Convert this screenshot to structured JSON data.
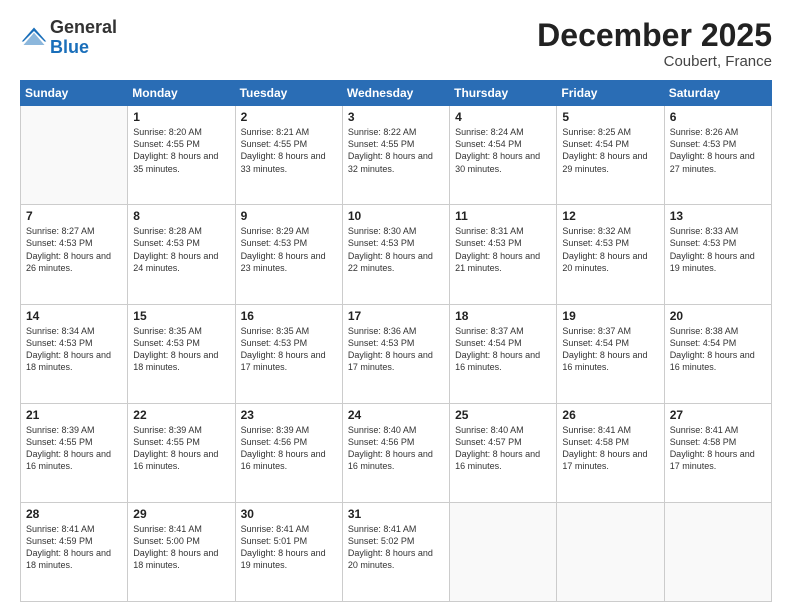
{
  "logo": {
    "general": "General",
    "blue": "Blue"
  },
  "header": {
    "month": "December 2025",
    "location": "Coubert, France"
  },
  "days_of_week": [
    "Sunday",
    "Monday",
    "Tuesday",
    "Wednesday",
    "Thursday",
    "Friday",
    "Saturday"
  ],
  "weeks": [
    [
      {
        "day": "",
        "sunrise": "",
        "sunset": "",
        "daylight": ""
      },
      {
        "day": "1",
        "sunrise": "Sunrise: 8:20 AM",
        "sunset": "Sunset: 4:55 PM",
        "daylight": "Daylight: 8 hours and 35 minutes."
      },
      {
        "day": "2",
        "sunrise": "Sunrise: 8:21 AM",
        "sunset": "Sunset: 4:55 PM",
        "daylight": "Daylight: 8 hours and 33 minutes."
      },
      {
        "day": "3",
        "sunrise": "Sunrise: 8:22 AM",
        "sunset": "Sunset: 4:55 PM",
        "daylight": "Daylight: 8 hours and 32 minutes."
      },
      {
        "day": "4",
        "sunrise": "Sunrise: 8:24 AM",
        "sunset": "Sunset: 4:54 PM",
        "daylight": "Daylight: 8 hours and 30 minutes."
      },
      {
        "day": "5",
        "sunrise": "Sunrise: 8:25 AM",
        "sunset": "Sunset: 4:54 PM",
        "daylight": "Daylight: 8 hours and 29 minutes."
      },
      {
        "day": "6",
        "sunrise": "Sunrise: 8:26 AM",
        "sunset": "Sunset: 4:53 PM",
        "daylight": "Daylight: 8 hours and 27 minutes."
      }
    ],
    [
      {
        "day": "7",
        "sunrise": "Sunrise: 8:27 AM",
        "sunset": "Sunset: 4:53 PM",
        "daylight": "Daylight: 8 hours and 26 minutes."
      },
      {
        "day": "8",
        "sunrise": "Sunrise: 8:28 AM",
        "sunset": "Sunset: 4:53 PM",
        "daylight": "Daylight: 8 hours and 24 minutes."
      },
      {
        "day": "9",
        "sunrise": "Sunrise: 8:29 AM",
        "sunset": "Sunset: 4:53 PM",
        "daylight": "Daylight: 8 hours and 23 minutes."
      },
      {
        "day": "10",
        "sunrise": "Sunrise: 8:30 AM",
        "sunset": "Sunset: 4:53 PM",
        "daylight": "Daylight: 8 hours and 22 minutes."
      },
      {
        "day": "11",
        "sunrise": "Sunrise: 8:31 AM",
        "sunset": "Sunset: 4:53 PM",
        "daylight": "Daylight: 8 hours and 21 minutes."
      },
      {
        "day": "12",
        "sunrise": "Sunrise: 8:32 AM",
        "sunset": "Sunset: 4:53 PM",
        "daylight": "Daylight: 8 hours and 20 minutes."
      },
      {
        "day": "13",
        "sunrise": "Sunrise: 8:33 AM",
        "sunset": "Sunset: 4:53 PM",
        "daylight": "Daylight: 8 hours and 19 minutes."
      }
    ],
    [
      {
        "day": "14",
        "sunrise": "Sunrise: 8:34 AM",
        "sunset": "Sunset: 4:53 PM",
        "daylight": "Daylight: 8 hours and 18 minutes."
      },
      {
        "day": "15",
        "sunrise": "Sunrise: 8:35 AM",
        "sunset": "Sunset: 4:53 PM",
        "daylight": "Daylight: 8 hours and 18 minutes."
      },
      {
        "day": "16",
        "sunrise": "Sunrise: 8:35 AM",
        "sunset": "Sunset: 4:53 PM",
        "daylight": "Daylight: 8 hours and 17 minutes."
      },
      {
        "day": "17",
        "sunrise": "Sunrise: 8:36 AM",
        "sunset": "Sunset: 4:53 PM",
        "daylight": "Daylight: 8 hours and 17 minutes."
      },
      {
        "day": "18",
        "sunrise": "Sunrise: 8:37 AM",
        "sunset": "Sunset: 4:54 PM",
        "daylight": "Daylight: 8 hours and 16 minutes."
      },
      {
        "day": "19",
        "sunrise": "Sunrise: 8:37 AM",
        "sunset": "Sunset: 4:54 PM",
        "daylight": "Daylight: 8 hours and 16 minutes."
      },
      {
        "day": "20",
        "sunrise": "Sunrise: 8:38 AM",
        "sunset": "Sunset: 4:54 PM",
        "daylight": "Daylight: 8 hours and 16 minutes."
      }
    ],
    [
      {
        "day": "21",
        "sunrise": "Sunrise: 8:39 AM",
        "sunset": "Sunset: 4:55 PM",
        "daylight": "Daylight: 8 hours and 16 minutes."
      },
      {
        "day": "22",
        "sunrise": "Sunrise: 8:39 AM",
        "sunset": "Sunset: 4:55 PM",
        "daylight": "Daylight: 8 hours and 16 minutes."
      },
      {
        "day": "23",
        "sunrise": "Sunrise: 8:39 AM",
        "sunset": "Sunset: 4:56 PM",
        "daylight": "Daylight: 8 hours and 16 minutes."
      },
      {
        "day": "24",
        "sunrise": "Sunrise: 8:40 AM",
        "sunset": "Sunset: 4:56 PM",
        "daylight": "Daylight: 8 hours and 16 minutes."
      },
      {
        "day": "25",
        "sunrise": "Sunrise: 8:40 AM",
        "sunset": "Sunset: 4:57 PM",
        "daylight": "Daylight: 8 hours and 16 minutes."
      },
      {
        "day": "26",
        "sunrise": "Sunrise: 8:41 AM",
        "sunset": "Sunset: 4:58 PM",
        "daylight": "Daylight: 8 hours and 17 minutes."
      },
      {
        "day": "27",
        "sunrise": "Sunrise: 8:41 AM",
        "sunset": "Sunset: 4:58 PM",
        "daylight": "Daylight: 8 hours and 17 minutes."
      }
    ],
    [
      {
        "day": "28",
        "sunrise": "Sunrise: 8:41 AM",
        "sunset": "Sunset: 4:59 PM",
        "daylight": "Daylight: 8 hours and 18 minutes."
      },
      {
        "day": "29",
        "sunrise": "Sunrise: 8:41 AM",
        "sunset": "Sunset: 5:00 PM",
        "daylight": "Daylight: 8 hours and 18 minutes."
      },
      {
        "day": "30",
        "sunrise": "Sunrise: 8:41 AM",
        "sunset": "Sunset: 5:01 PM",
        "daylight": "Daylight: 8 hours and 19 minutes."
      },
      {
        "day": "31",
        "sunrise": "Sunrise: 8:41 AM",
        "sunset": "Sunset: 5:02 PM",
        "daylight": "Daylight: 8 hours and 20 minutes."
      },
      {
        "day": "",
        "sunrise": "",
        "sunset": "",
        "daylight": ""
      },
      {
        "day": "",
        "sunrise": "",
        "sunset": "",
        "daylight": ""
      },
      {
        "day": "",
        "sunrise": "",
        "sunset": "",
        "daylight": ""
      }
    ]
  ]
}
